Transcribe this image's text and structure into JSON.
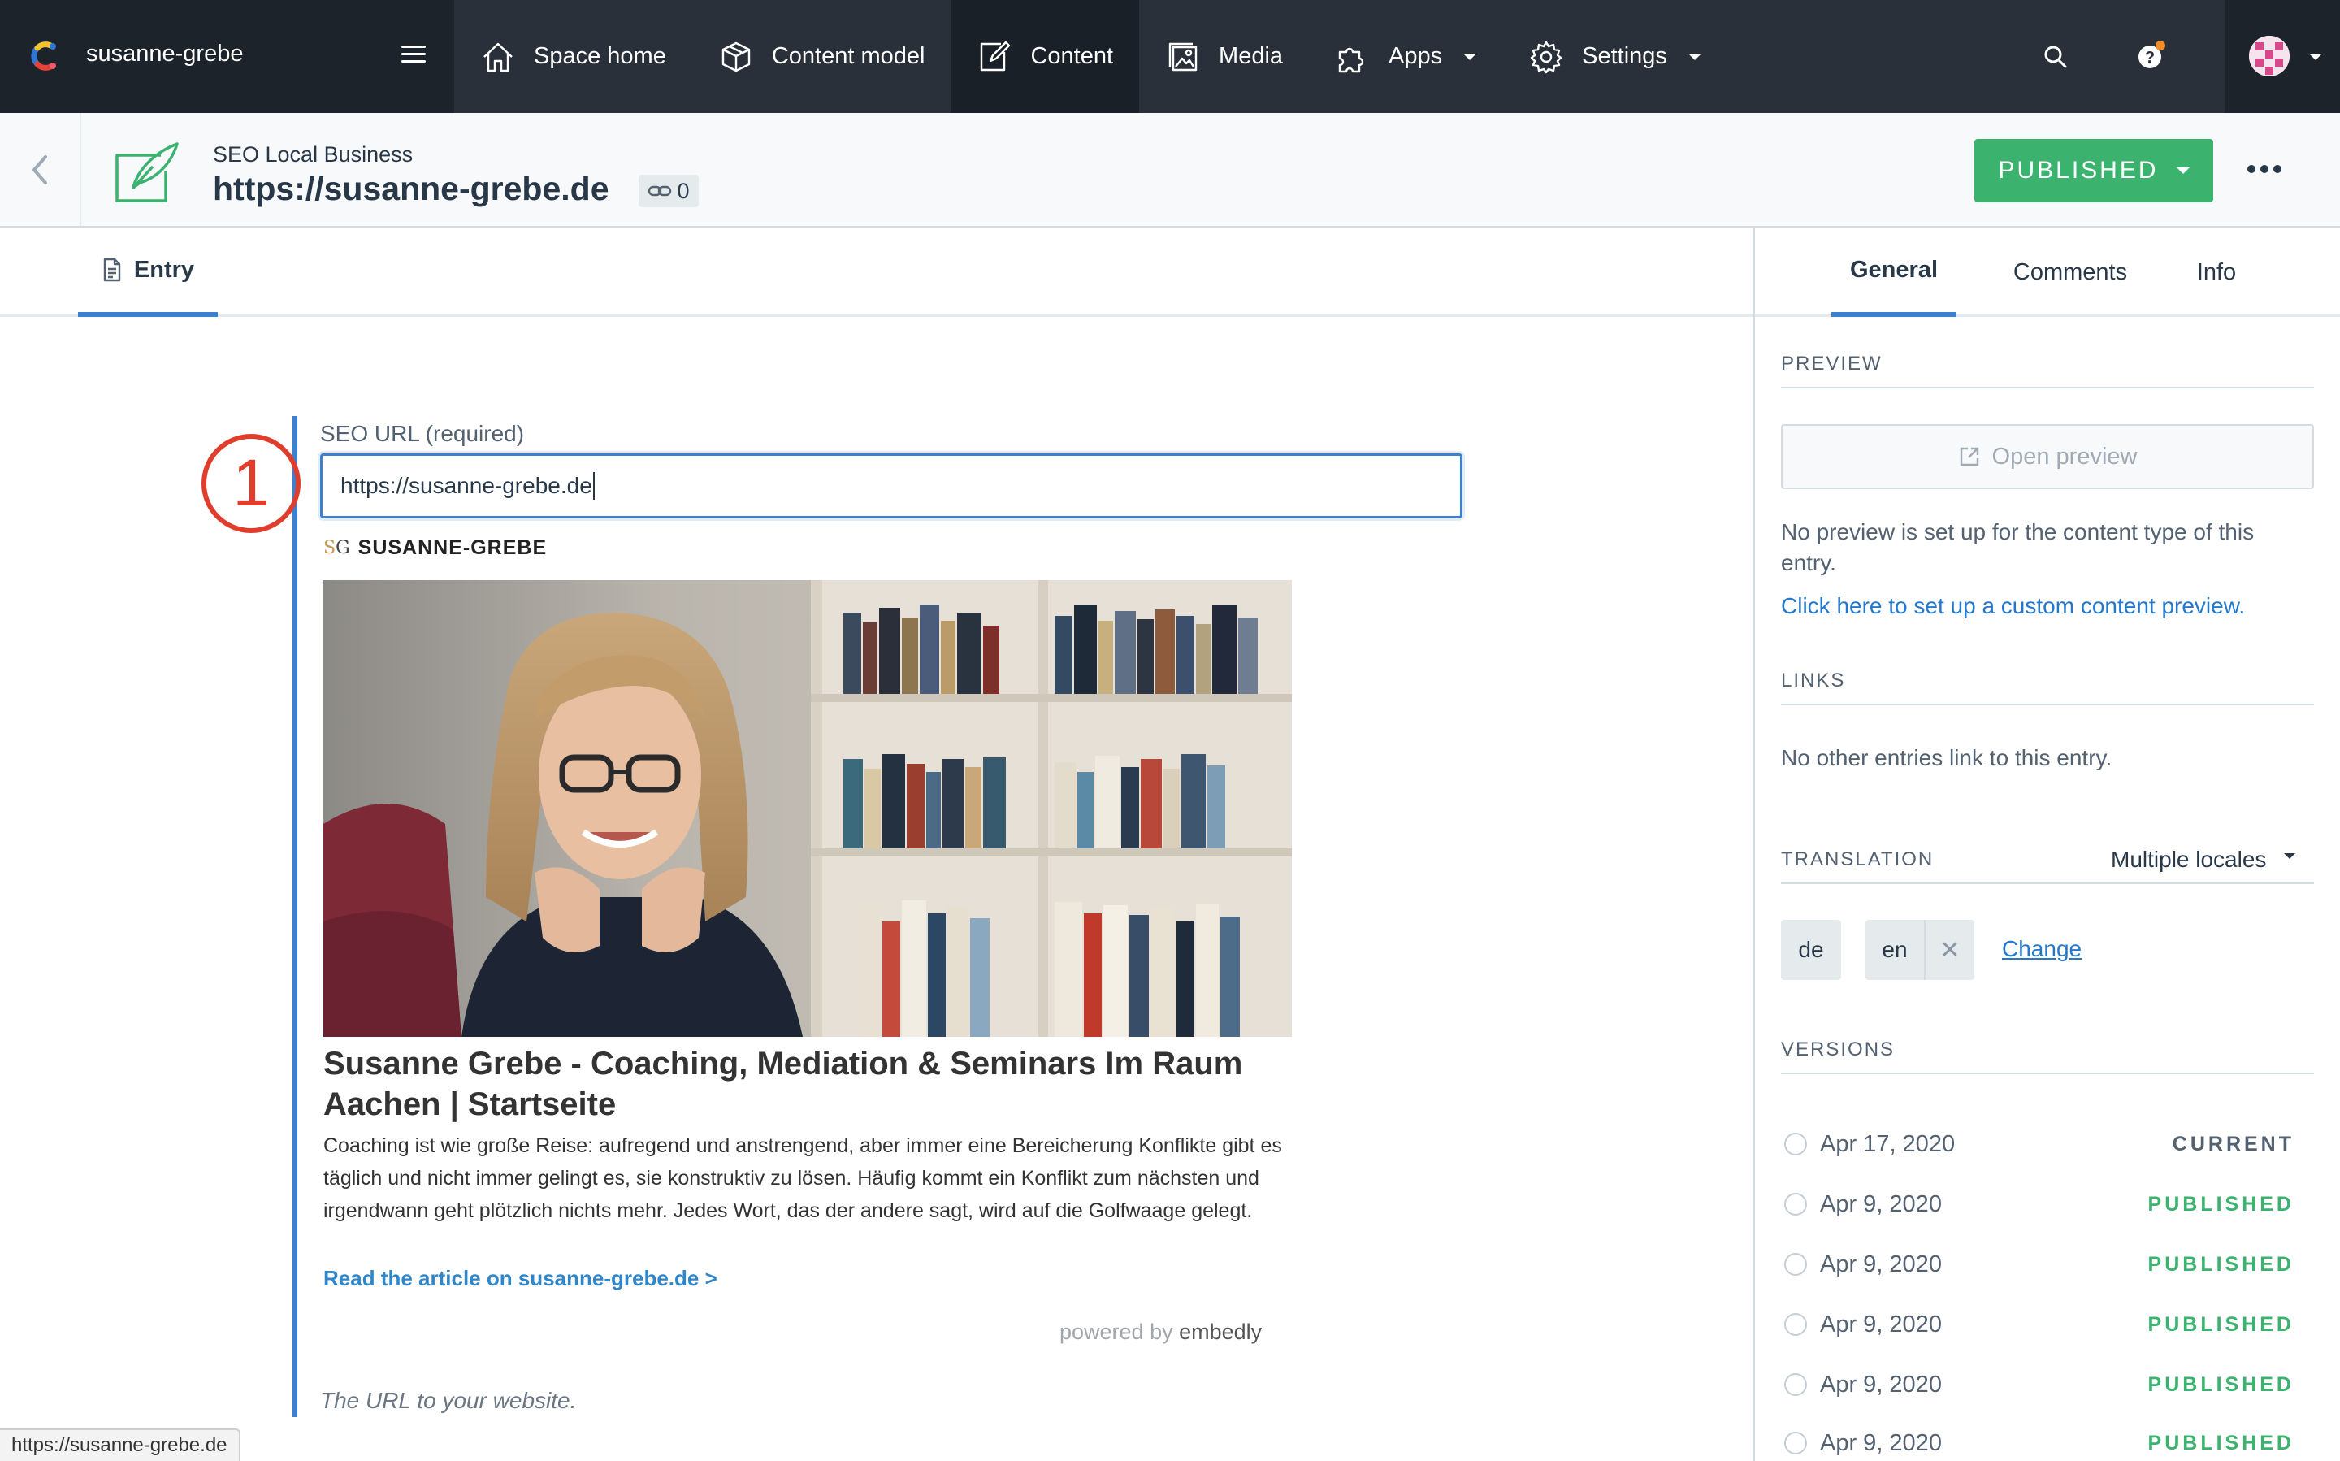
{
  "topnav": {
    "space_name": "susanne-grebe",
    "items": [
      {
        "label": "Space home",
        "icon": "home-icon"
      },
      {
        "label": "Content model",
        "icon": "content-model-icon"
      },
      {
        "label": "Content",
        "icon": "content-icon",
        "active": true
      },
      {
        "label": "Media",
        "icon": "media-icon"
      },
      {
        "label": "Apps",
        "icon": "apps-icon",
        "dropdown": true
      },
      {
        "label": "Settings",
        "icon": "gear-icon",
        "dropdown": true
      }
    ]
  },
  "entry_header": {
    "content_type": "SEO Local Business",
    "title": "https://susanne-grebe.de",
    "references_count": "0",
    "status_button": "PUBLISHED"
  },
  "editor_tabs": {
    "entry": "Entry"
  },
  "field": {
    "label": "SEO URL (required)",
    "value": "https://susanne-grebe.de",
    "help_text": "The URL to your website.",
    "annotation_number": "1"
  },
  "embed": {
    "brand_mark_left": "S",
    "brand_mark_right": "G",
    "brand_name": "SUSANNE-GREBE",
    "title": "Susanne Grebe - Coaching, Mediation & Seminars Im Raum Aachen | Startseite",
    "description": "Coaching ist wie große Reise: aufregend und anstrengend, aber immer eine Bereicherung Konflikte gibt es täglich und nicht immer gelingt es, sie konstruktiv zu lösen. Häufig kommt ein Konflikt zum nächsten und irgendwann geht plötzlich nichts mehr. Jedes Wort, das der andere sagt, wird auf die Golfwaage gelegt.",
    "link": "Read the article on susanne-grebe.de >",
    "powered_prefix": "powered by",
    "powered_brand": "embedly"
  },
  "status_bar_url": "https://susanne-grebe.de",
  "sidebar": {
    "tabs": [
      "General",
      "Comments",
      "Info"
    ],
    "preview": {
      "title": "PREVIEW",
      "button": "Open preview",
      "note": "No preview is set up for the content type of this entry.",
      "link": "Click here to set up a custom content preview."
    },
    "links": {
      "title": "LINKS",
      "note": "No other entries link to this entry."
    },
    "translation": {
      "title": "TRANSLATION",
      "mode": "Multiple locales",
      "locales": [
        "de",
        "en"
      ],
      "change": "Change"
    },
    "versions": {
      "title": "VERSIONS",
      "items": [
        {
          "date": "Apr 17, 2020",
          "status": "CURRENT"
        },
        {
          "date": "Apr 9, 2020",
          "status": "PUBLISHED"
        },
        {
          "date": "Apr 9, 2020",
          "status": "PUBLISHED"
        },
        {
          "date": "Apr 9, 2020",
          "status": "PUBLISHED"
        },
        {
          "date": "Apr 9, 2020",
          "status": "PUBLISHED"
        },
        {
          "date": "Apr 9, 2020",
          "status": "PUBLISHED"
        }
      ]
    }
  },
  "colors": {
    "nav_bg": "#2a3039",
    "accent": "#3c80cf",
    "published": "#3bb36f",
    "annotation": "#e03e2d"
  }
}
